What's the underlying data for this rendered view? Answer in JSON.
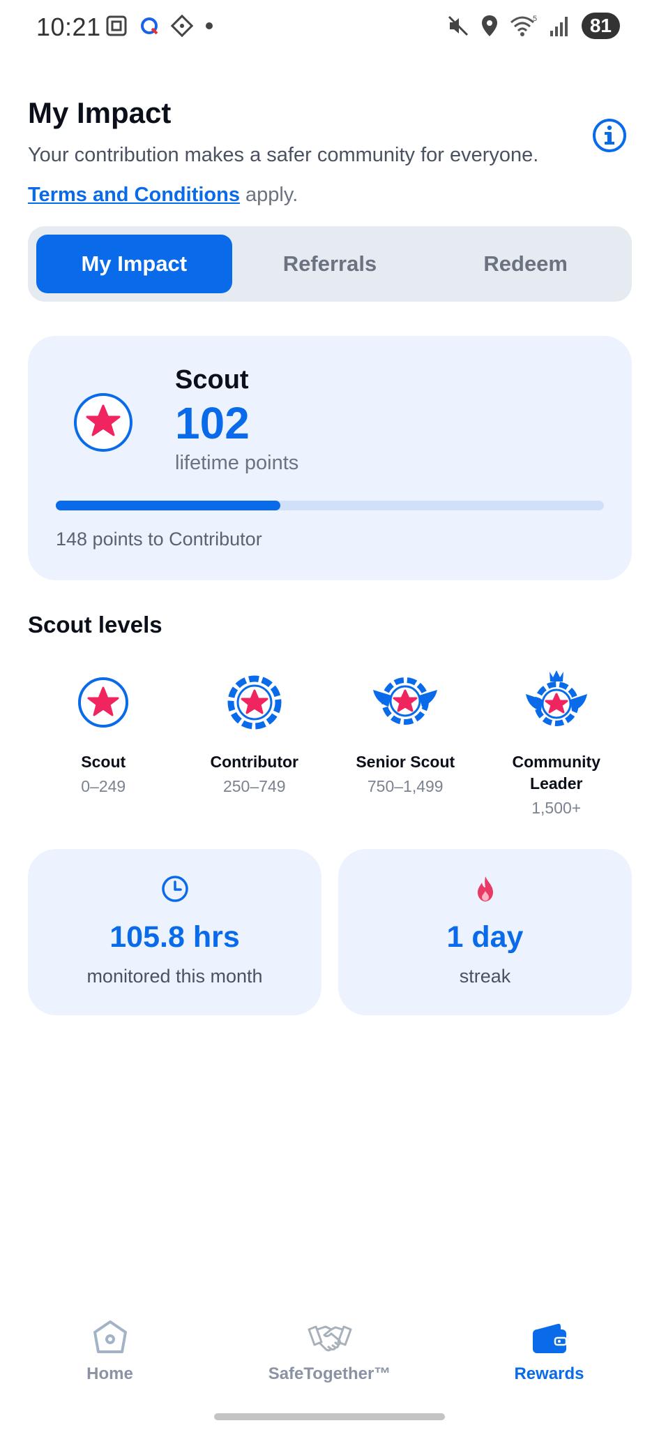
{
  "status_bar": {
    "time": "10:21",
    "battery": "81",
    "signal_label": "5"
  },
  "header": {
    "title": "My Impact",
    "subtitle": "Your contribution makes a safer community for everyone.",
    "terms_link": "Terms and Conditions",
    "terms_suffix": " apply."
  },
  "tabs": [
    {
      "label": "My Impact",
      "active": true
    },
    {
      "label": "Referrals",
      "active": false
    },
    {
      "label": "Redeem",
      "active": false
    }
  ],
  "level_card": {
    "level_name": "Scout",
    "points": "102",
    "points_label": "lifetime points",
    "progress_fraction": 0.41,
    "progress_caption": "148 points to Contributor"
  },
  "scout_levels": {
    "title": "Scout levels",
    "items": [
      {
        "name": "Scout",
        "range": "0–249",
        "icon": "scout-badge-icon"
      },
      {
        "name": "Contributor",
        "range": "250–749",
        "icon": "contributor-badge-icon"
      },
      {
        "name": "Senior Scout",
        "range": "750–1,499",
        "icon": "senior-scout-badge-icon"
      },
      {
        "name": "Community Leader",
        "range": "1,500+",
        "icon": "community-leader-badge-icon"
      }
    ]
  },
  "stats": [
    {
      "icon": "clock-icon",
      "value": "105.8 hrs",
      "label": "monitored this month"
    },
    {
      "icon": "flame-icon",
      "value": "1 day",
      "label": "streak"
    }
  ],
  "bottom_nav": [
    {
      "label": "Home",
      "icon": "home-icon",
      "active": false
    },
    {
      "label": "SafeTogether™",
      "icon": "handshake-icon",
      "active": false
    },
    {
      "label": "Rewards",
      "icon": "wallet-icon",
      "active": true
    }
  ],
  "colors": {
    "accent": "#0a6bea",
    "star": "#f0245f",
    "card_bg": "#edf3fe"
  }
}
